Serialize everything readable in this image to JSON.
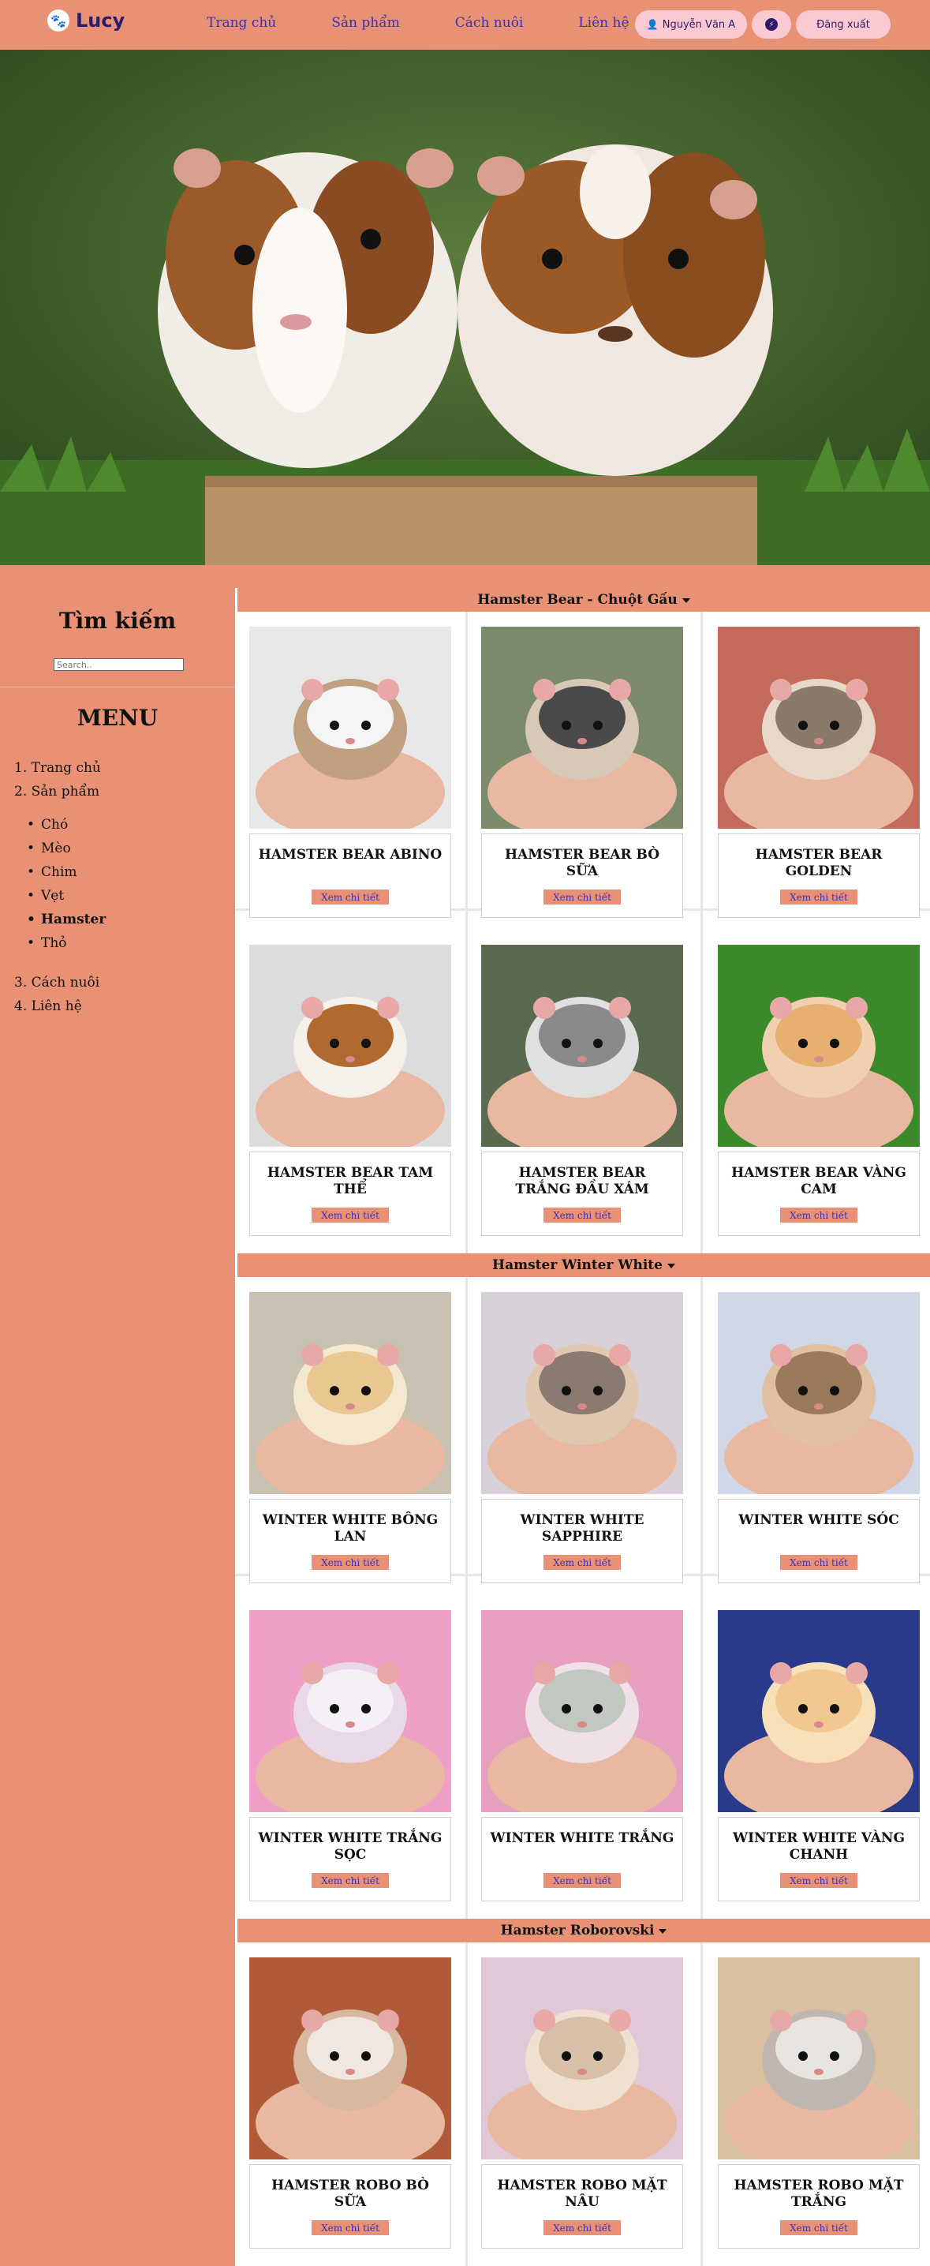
{
  "nav": {
    "logo": "Lucy",
    "links": [
      "Trang chủ",
      "Sản phẩm",
      "Cách nuôi",
      "Liên hệ"
    ],
    "user_name": "Nguyễn Văn A",
    "logout_label": "Đăng xuất"
  },
  "sidebar": {
    "search_title": "Tìm kiếm",
    "search_placeholder": "Search..",
    "menu_title": "MENU",
    "items": [
      "1. Trang chủ",
      "2. Sản phẩm",
      "3. Cách nuôi",
      "4. Liên hệ"
    ],
    "sub_items": [
      "Chó",
      "Mèo",
      "Chim",
      "Vẹt",
      "Hamster",
      "Thỏ"
    ],
    "active_sub_item": "Hamster"
  },
  "categories": [
    {
      "title": "Hamster Bear - Chuột Gấu",
      "products": [
        {
          "name": "HAMSTER BEAR ABINO",
          "button": "Xem chi tiết"
        },
        {
          "name": "HAMSTER BEAR BÒ SỮA",
          "button": "Xem chi tiết"
        },
        {
          "name": "HAMSTER BEAR GOLDEN",
          "button": "Xem chi tiết"
        },
        {
          "name": "HAMSTER BEAR TAM THỂ",
          "button": "Xem chi tiết"
        },
        {
          "name": "HAMSTER BEAR TRẮNG ĐẦU XÁM",
          "button": "Xem chi tiết"
        },
        {
          "name": "HAMSTER BEAR VÀNG CAM",
          "button": "Xem chi tiết"
        }
      ]
    },
    {
      "title": "Hamster Winter White",
      "products": [
        {
          "name": "WINTER WHITE BÔNG LAN",
          "button": "Xem chi tiết"
        },
        {
          "name": "WINTER WHITE SAPPHIRE",
          "button": "Xem chi tiết"
        },
        {
          "name": "WINTER WHITE SÓC",
          "button": "Xem chi tiết"
        },
        {
          "name": "WINTER WHITE TRẮNG SỌC",
          "button": "Xem chi tiết"
        },
        {
          "name": "WINTER WHITE TRẮNG",
          "button": "Xem chi tiết"
        },
        {
          "name": "WINTER WHITE VÀNG CHANH",
          "button": "Xem chi tiết"
        }
      ]
    },
    {
      "title": "Hamster Roborovski",
      "products": [
        {
          "name": "HAMSTER ROBO BÒ SỮA",
          "button": "Xem chi tiết"
        },
        {
          "name": "HAMSTER ROBO MẶT NÂU",
          "button": "Xem chi tiết"
        },
        {
          "name": "HAMSTER ROBO MẶT TRẮNG",
          "button": "Xem chi tiết"
        }
      ]
    }
  ],
  "colors": {
    "background": "#e89175",
    "nav_link": "#3d2db8",
    "pill": "#fbc9d2",
    "logo_text": "#2a1b6b"
  }
}
